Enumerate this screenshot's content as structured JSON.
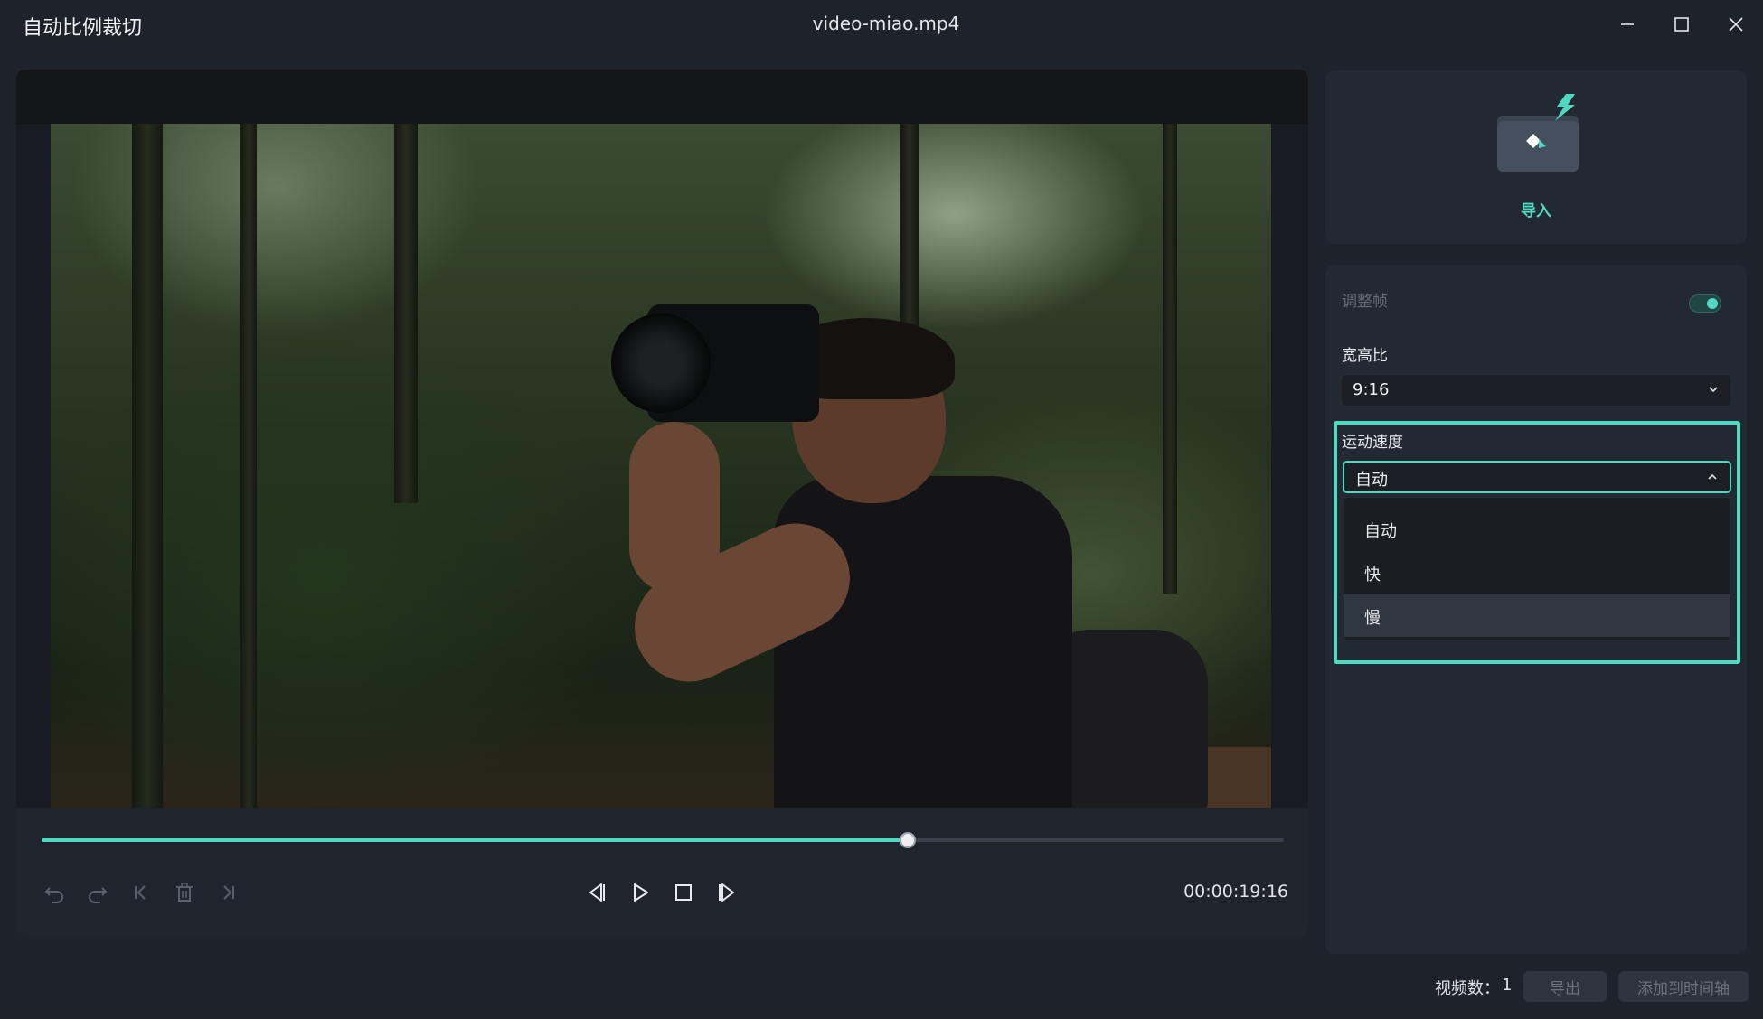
{
  "window": {
    "app_title": "自动比例裁切",
    "file_title": "video-miao.mp4"
  },
  "player": {
    "progress": 0.697,
    "timecode": "00:00:19:16"
  },
  "import": {
    "label": "导入"
  },
  "settings": {
    "adjust_frame_label": "调整帧",
    "adjust_frame_enabled": true,
    "aspect_ratio_label": "宽高比",
    "aspect_ratio_value": "9:16",
    "motion_speed_label": "运动速度",
    "motion_speed_value": "自动",
    "motion_speed_options": [
      "自动",
      "快",
      "慢"
    ],
    "hovered_option": "慢"
  },
  "footer": {
    "video_count_label": "视频数：",
    "video_count": "1",
    "export_label": "导出",
    "add_to_timeline_label": "添加到时间轴"
  },
  "colors": {
    "accent": "#4fd9c1",
    "background": "#1e232b",
    "panel": "#232932"
  }
}
